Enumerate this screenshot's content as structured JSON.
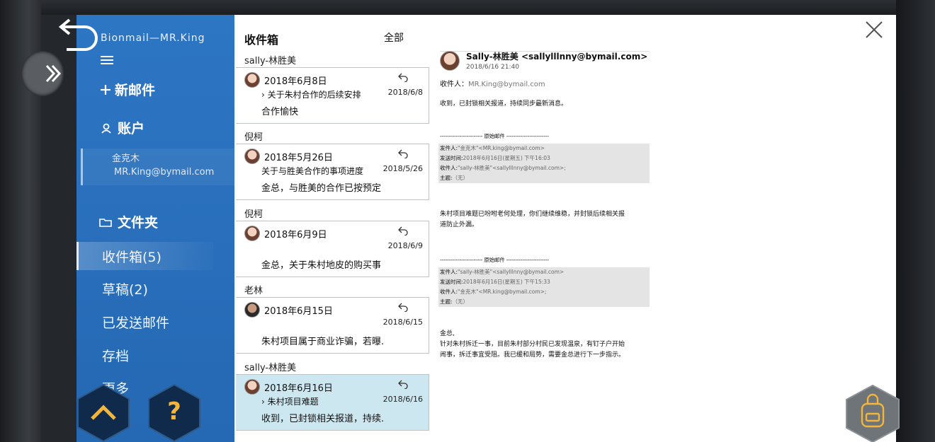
{
  "sidebar": {
    "brand": "Bionmail—MR.King",
    "new_mail": "新邮件",
    "account_label": "账户",
    "account_name": "金克木",
    "account_email": "MR.King@bymail.com",
    "folders_label": "文件夹",
    "items": [
      {
        "label": "收件箱(5)"
      },
      {
        "label": "草稿(2)"
      },
      {
        "label": "已发送邮件"
      },
      {
        "label": "存档"
      },
      {
        "label": "更多"
      }
    ]
  },
  "list": {
    "title": "收件箱",
    "filter": "全部",
    "groups": [
      {
        "sender": "sally-林胜美",
        "date": "2018年6月8日",
        "short_date": "2018/6/8",
        "subject": "› 关于朱村合作的后续安排",
        "preview": "合作愉快"
      },
      {
        "sender": "倪柯",
        "date": "2018年5月26日",
        "short_date": "2018/5/26",
        "subject": "  关于与胜美合作的事项进度",
        "preview": "金总，与胜美的合作已按预定"
      },
      {
        "sender": "倪柯",
        "date": "2018年6月9日",
        "short_date": "2018/6/9",
        "subject": "",
        "preview": "金总，关于朱村地皮的购买事"
      },
      {
        "sender": "老林",
        "date": "2018年6月15日",
        "short_date": "2018/6/15",
        "subject": "",
        "preview": "朱村项目属于商业诈骗，若曝."
      },
      {
        "sender": "sally-林胜美",
        "date": "2018年6月16日",
        "short_date": "2018/6/16",
        "subject": "› 朱村项目难题",
        "preview": "收到，已封锁相关报道，持续."
      }
    ]
  },
  "reading": {
    "from": "Sally-林胜美 <sallylllnny@bymail.com>",
    "time": "2018/6/16  21:40",
    "to_label": "收件人：",
    "to_value": "MR.King@bymail.com",
    "body": "收到，已封锁相关报道，持续同步最新消息。",
    "sep1": "------------------------ 原始邮件 ------------------------",
    "q1": {
      "from_label": "发件人:",
      "from_value": "\"金克木\"<MR.king@bymail.com>",
      "time_label": "发送时间:",
      "time_value": "2018年6月16日(星期五) 下午16:03",
      "to_label": "收件人:",
      "to_value": "\"sally-林胜美\"<sallylllnny@bymail.com>;",
      "subject_label": "主题:",
      "subject_value": "（无）"
    },
    "para2_line1": "朱村项目难题已吩咐老何处理，你们继续维稳，并封锁后续相关报",
    "para2_line2": "道防止外漏。",
    "sep2": "------------------------ 原始邮件 ------------------------",
    "q2": {
      "from_label": "发件人:",
      "from_value": "\"sally-林胜美\"<sallylllnny@bymail.com>",
      "time_label": "发送时间:",
      "time_value": "2018年6月16日(星期五) 下午15:33",
      "to_label": "收件人:",
      "to_value": "\"金克木\"<MR.king@bymail.com>;",
      "subject_label": "主题:",
      "subject_value": "（无）"
    },
    "para3_line1": "金总,",
    "para3_line2": "针对朱村拆迁一事，目前朱村部分村民已发现温泉，有钉子户开始",
    "para3_line3": "闹事，拆迁事宜受阻。我已缓和局势，需要金总进行下一步指示。"
  },
  "hud": {
    "help_label": "?"
  }
}
